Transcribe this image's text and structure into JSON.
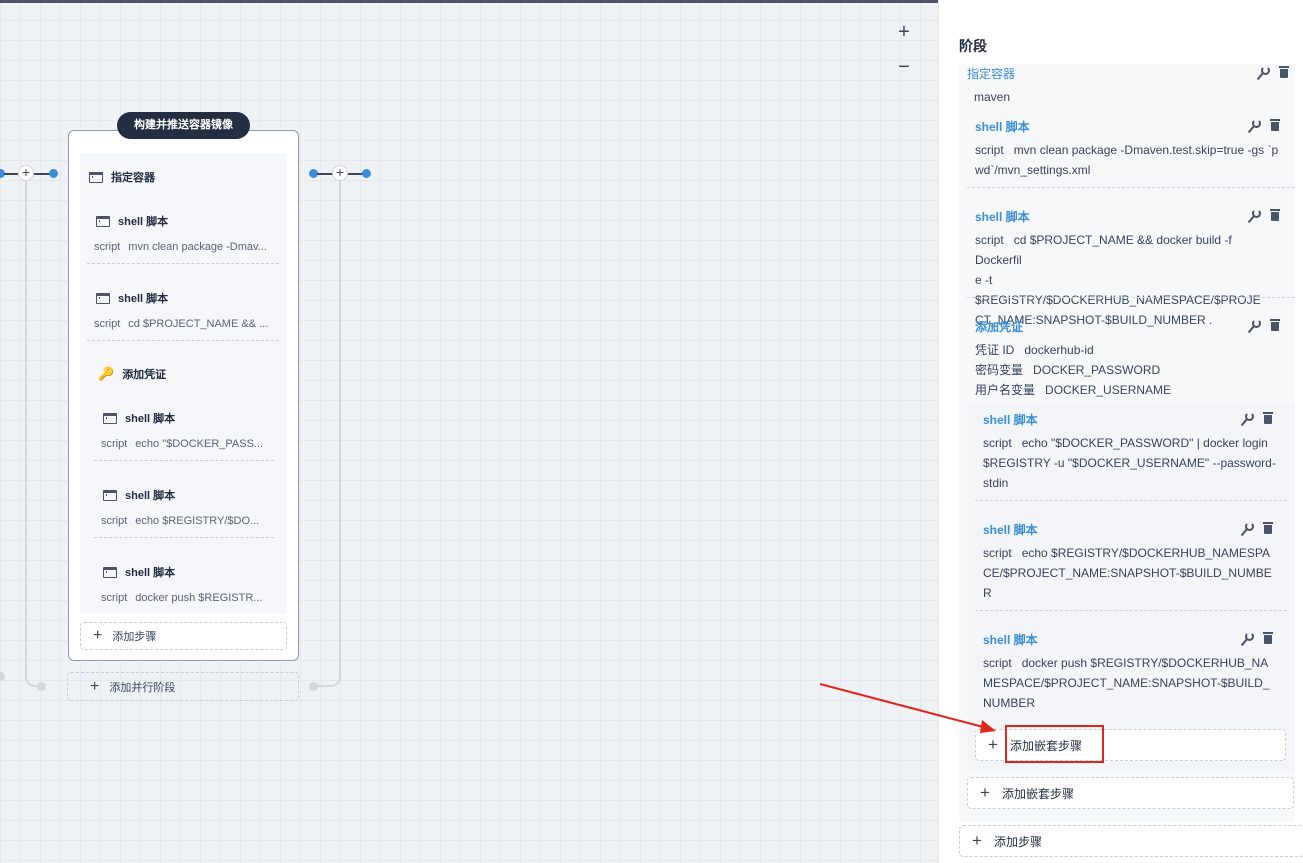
{
  "canvas": {
    "zoom_in": "+",
    "zoom_out": "−",
    "stage": {
      "title": "构建并推送容器镜像",
      "steps": [
        {
          "icon": "terminal-icon",
          "name": "指定容器",
          "sub_key": "",
          "sub_val": ""
        },
        {
          "icon": "terminal-icon",
          "name": "shell 脚本",
          "sub_key": "script",
          "sub_val": "mvn clean package -Dmav..."
        },
        {
          "icon": "terminal-icon",
          "name": "shell 脚本",
          "sub_key": "script",
          "sub_val": "cd $PROJECT_NAME && ..."
        },
        {
          "icon": "key-icon",
          "name": "添加凭证",
          "sub_key": "",
          "sub_val": ""
        },
        {
          "icon": "terminal-icon",
          "name": "shell 脚本",
          "sub_key": "script",
          "sub_val": "echo \"$DOCKER_PASS..."
        },
        {
          "icon": "terminal-icon",
          "name": "shell 脚本",
          "sub_key": "script",
          "sub_val": "echo $REGISTRY/$DO..."
        },
        {
          "icon": "terminal-icon",
          "name": "shell 脚本",
          "sub_key": "script",
          "sub_val": "docker push $REGISTR..."
        }
      ],
      "add_step": "添加步骤"
    },
    "add_parallel_stage": "添加并行阶段"
  },
  "panel": {
    "title": "阶段",
    "container": {
      "label": "指定容器",
      "value": "maven"
    },
    "container_steps": [
      {
        "name": "shell 脚本",
        "key": "script",
        "value": "mvn clean package -Dmaven.test.skip=true -gs `p",
        "value2": "wd`/mvn_settings.xml",
        "value3": ""
      },
      {
        "name": "shell 脚本",
        "key": "script",
        "value": "cd $PROJECT_NAME && docker build -f Dockerfil",
        "value2": "e -t $REGISTRY/$DOCKERHUB_NAMESPACE/$PROJE",
        "value3": "CT_NAME:SNAPSHOT-$BUILD_NUMBER ."
      }
    ],
    "credential": {
      "label": "添加凭证",
      "rows": [
        {
          "key": "凭证 ID",
          "value": "dockerhub-id"
        },
        {
          "key": "密码变量",
          "value": "DOCKER_PASSWORD"
        },
        {
          "key": "用户名变量",
          "value": "DOCKER_USERNAME"
        }
      ]
    },
    "nested_steps": [
      {
        "name": "shell 脚本",
        "key": "script",
        "value": "echo \"$DOCKER_PASSWORD\" | docker login",
        "value2": "$REGISTRY -u \"$DOCKER_USERNAME\" --password-",
        "value3": "stdin"
      },
      {
        "name": "shell 脚本",
        "key": "script",
        "value": "echo $REGISTRY/$DOCKERHUB_NAMESPA",
        "value2": "CE/$PROJECT_NAME:SNAPSHOT-$BUILD_NUMBE",
        "value3": "R"
      },
      {
        "name": "shell 脚本",
        "key": "script",
        "value": "docker push $REGISTRY/$DOCKERHUB_NA",
        "value2": "MESPACE/$PROJECT_NAME:SNAPSHOT-$BUILD_",
        "value3": "NUMBER"
      }
    ],
    "add_nested_inner": "添加嵌套步骤",
    "add_nested_outer": "添加嵌套步骤",
    "add_step": "添加步骤"
  },
  "colors": {
    "link": "#3b8fd6",
    "highlight": "#e1251b",
    "stage_title_bg": "#242e42"
  }
}
